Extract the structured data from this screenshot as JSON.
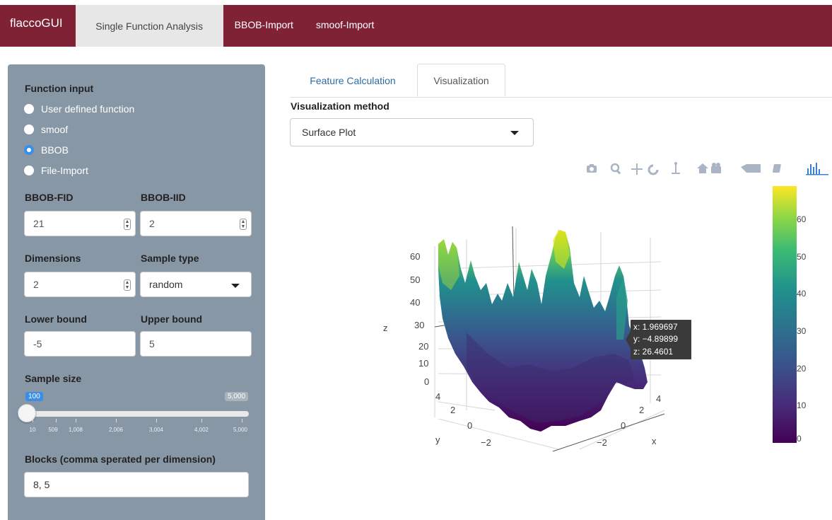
{
  "app": {
    "brand": "flaccoGUI",
    "nav_tabs": [
      "Single Function Analysis",
      "BBOB-Import",
      "smoof-Import"
    ]
  },
  "sidebar": {
    "function_input_label": "Function input",
    "radio_options": [
      "User defined function",
      "smoof",
      "BBOB",
      "File-Import"
    ],
    "selected_option": "BBOB",
    "bbob_fid_label": "BBOB-FID",
    "bbob_fid_value": "21",
    "bbob_iid_label": "BBOB-IID",
    "bbob_iid_value": "2",
    "dimensions_label": "Dimensions",
    "dimensions_value": "2",
    "sample_type_label": "Sample type",
    "sample_type_value": "random",
    "lower_bound_label": "Lower bound",
    "lower_bound_value": "-5",
    "upper_bound_label": "Upper bound",
    "upper_bound_value": "5",
    "sample_size_label": "Sample size",
    "sample_size_value": "100",
    "sample_size_max_label": "5,000",
    "slider_ticks": [
      "10",
      "509",
      "1,008",
      "2,006",
      "3,004",
      "4,002",
      "5,000"
    ],
    "blocks_label": "Blocks (comma sperated per dimension)",
    "blocks_value": "8, 5"
  },
  "main": {
    "tabs": [
      "Feature Calculation",
      "Visualization"
    ],
    "active_tab": "Visualization",
    "vis_method_label": "Visualization method",
    "vis_method_value": "Surface Plot",
    "modebar_icons": [
      "camera-icon",
      "zoom-icon",
      "pan-icon",
      "orbit-icon",
      "turntable-icon",
      "home-icon",
      "camera-view-icon",
      "hover-icon",
      "spikelines-icon",
      "plotly-logo-icon"
    ]
  },
  "plot": {
    "z_axis_label": "z",
    "y_axis_label": "y",
    "x_axis_label": "x",
    "z_ticks": [
      "60",
      "50",
      "40",
      "30",
      "20",
      "10",
      "0"
    ],
    "y_ticks": [
      "4",
      "2",
      "0",
      "−2"
    ],
    "x_ticks": [
      "4",
      "2",
      "0",
      "−2"
    ],
    "colorbar_ticks": [
      "60",
      "50",
      "40",
      "30",
      "20",
      "10",
      "0"
    ],
    "tooltip": [
      "x: 1.969697",
      "y: −4.89899",
      "z: 26.4601"
    ]
  }
}
